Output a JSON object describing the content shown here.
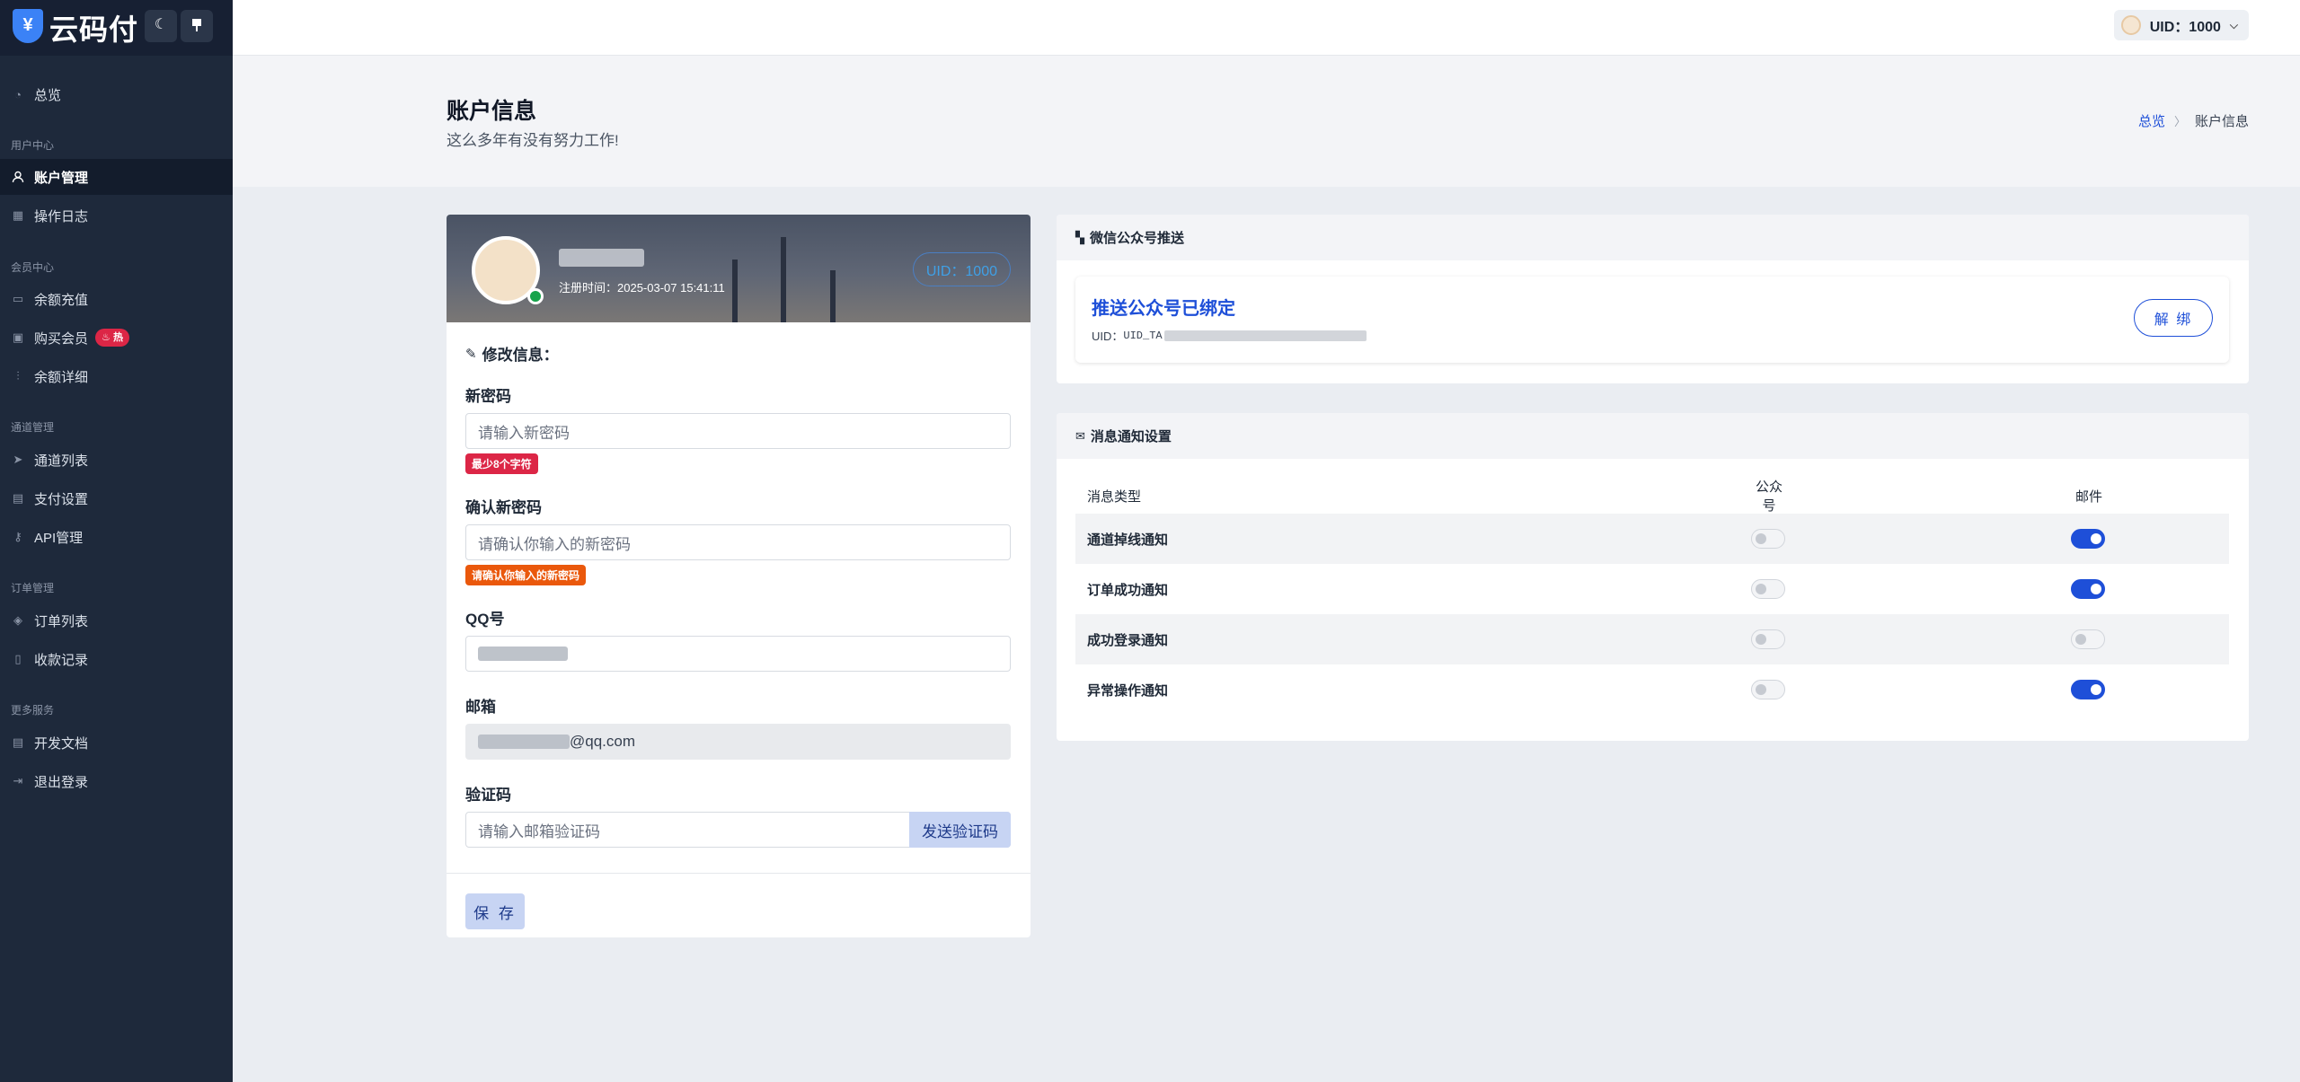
{
  "brand": {
    "logo_glyph": "¥",
    "name": "云码付"
  },
  "sidebar": {
    "theme_icon": "moon-icon",
    "pin_icon": "pin-icon",
    "overview": "总览",
    "sections": {
      "user": "用户中心",
      "member": "会员中心",
      "channel": "通道管理",
      "order": "订单管理",
      "more": "更多服务"
    },
    "items": {
      "account": "账户管理",
      "oplog": "操作日志",
      "recharge": "余额充值",
      "buy_vip": "购买会员",
      "hot_badge": "热",
      "balance_detail": "余额详细",
      "channel_list": "通道列表",
      "pay_settings": "支付设置",
      "api": "API管理",
      "order_list": "订单列表",
      "receipts": "收款记录",
      "docs": "开发文档",
      "logout": "退出登录"
    }
  },
  "topbar": {
    "uid_label": "UID：1000"
  },
  "header": {
    "title": "账户信息",
    "subtitle": "这么多年有没有努力工作!",
    "breadcrumb_home": "总览",
    "breadcrumb_current": "账户信息"
  },
  "profile": {
    "reg_time": "注册时间：2025-03-07 15:41:11",
    "uid_chip": "UID：1000"
  },
  "form": {
    "section_title": "修改信息：",
    "new_password_label": "新密码",
    "new_password_placeholder": "请输入新密码",
    "new_password_hint": "最少8个字符",
    "confirm_label": "确认新密码",
    "confirm_placeholder": "请确认你输入的新密码",
    "confirm_hint": "请确认你输入的新密码",
    "qq_label": "QQ号",
    "email_label": "邮箱",
    "email_suffix": "@qq.com",
    "code_label": "验证码",
    "code_placeholder": "请输入邮箱验证码",
    "send_code": "发送验证码",
    "save": "保 存"
  },
  "wechat": {
    "title": "微信公众号推送",
    "bound_title": "推送公众号已绑定",
    "uid_prefix": "UID：",
    "uid_value": "UID_TA",
    "unbind": "解 绑"
  },
  "notify": {
    "title": "消息通知设置",
    "columns": [
      "消息类型",
      "公众号",
      "邮件"
    ],
    "rows": [
      {
        "name": "通道掉线通知",
        "wechat": false,
        "email": true
      },
      {
        "name": "订单成功通知",
        "wechat": false,
        "email": true
      },
      {
        "name": "成功登录通知",
        "wechat": false,
        "email": false
      },
      {
        "name": "异常操作通知",
        "wechat": false,
        "email": true
      }
    ]
  },
  "colors": {
    "primary": "#1e4fd8",
    "sidebar_bg": "#1e293b",
    "hot": "#dc2646",
    "warn": "#ea580c",
    "online": "#16a34a"
  }
}
